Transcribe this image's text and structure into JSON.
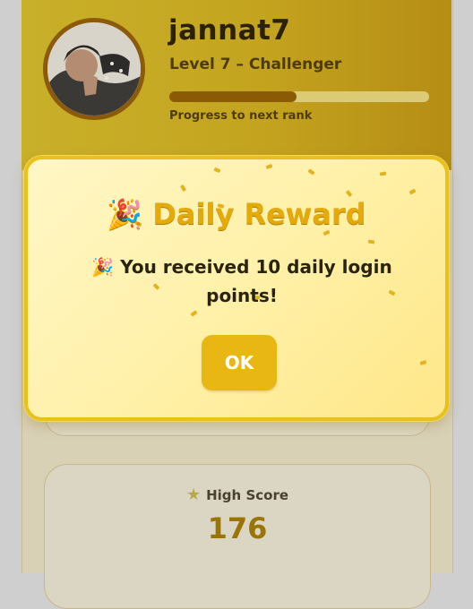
{
  "profile": {
    "username": "jannat7",
    "level": "Level 7 – Challenger",
    "progress_caption": "Progress to next rank",
    "progress_fraction": 0.49
  },
  "modal": {
    "title_icon": "🎉",
    "title": "Daily Reward",
    "message_icon": "🎉",
    "message": "You received 10 daily login points!",
    "ok_label": "OK"
  },
  "stats": {
    "high_score_icon": "★",
    "high_score_label": "High Score",
    "high_score_value": "176"
  }
}
